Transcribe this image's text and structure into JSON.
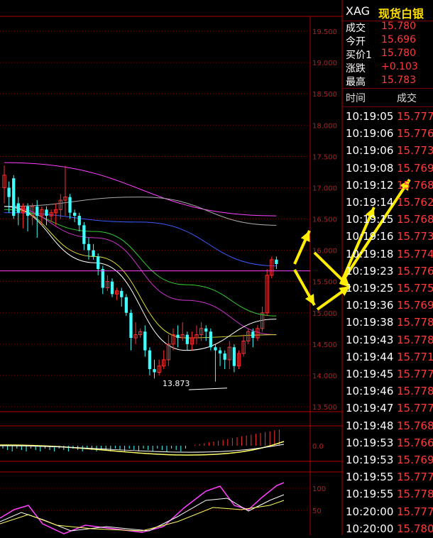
{
  "quote": {
    "symbol": "XAG",
    "name": "现货白银",
    "rows": [
      {
        "label": "成交",
        "value": "15.780"
      },
      {
        "label": "今开",
        "value": "15.696"
      },
      {
        "label": "买价1",
        "value": "15.780"
      },
      {
        "label": "涨跌",
        "value": "+0.103"
      },
      {
        "label": "最高",
        "value": "15.783"
      }
    ]
  },
  "trades": {
    "header_time": "时间",
    "header_price": "成交",
    "rows": [
      {
        "time": "10:19:05",
        "price": "15.777"
      },
      {
        "time": "10:19:06",
        "price": "15.776"
      },
      {
        "time": "10:19:06",
        "price": "15.773"
      },
      {
        "time": "10:19:08",
        "price": "15.769"
      },
      {
        "time": "10:19:12",
        "price": "15.768"
      },
      {
        "time": "10:19:14",
        "price": "15.762"
      },
      {
        "time": "10:19:15",
        "price": "15.768"
      },
      {
        "time": "10:19:16",
        "price": "15.773"
      },
      {
        "time": "10:19:18",
        "price": "15.774"
      },
      {
        "time": "10:19:23",
        "price": "15.776"
      },
      {
        "time": "10:19:25",
        "price": "15.775"
      },
      {
        "time": "10:19:36",
        "price": "15.769"
      },
      {
        "time": "10:19:38",
        "price": "15.778"
      },
      {
        "time": "10:19:43",
        "price": "15.778"
      },
      {
        "time": "10:19:44",
        "price": "15.771"
      },
      {
        "time": "10:19:45",
        "price": "15.777"
      },
      {
        "time": "10:19:46",
        "price": "15.778"
      },
      {
        "time": "10:19:47",
        "price": "15.777"
      },
      {
        "time": "10:19:48",
        "price": "15.768"
      },
      {
        "time": "10:19:53",
        "price": "15.766"
      },
      {
        "time": "10:19:53",
        "price": "15.769"
      },
      {
        "time": "10:19:55",
        "price": "15.777"
      },
      {
        "time": "10:19:55",
        "price": "15.778"
      },
      {
        "time": "10:20:00",
        "price": "15.777"
      },
      {
        "time": "10:20:00",
        "price": "15.780"
      }
    ]
  },
  "chart_data": [
    {
      "type": "candlestick",
      "ylim": [
        13.5,
        19.5
      ],
      "y_ticks": [
        "19.500",
        "19.000",
        "18.500",
        "18.000",
        "17.500",
        "17.000",
        "16.500",
        "16.000",
        "15.500",
        "15.000",
        "14.500",
        "14.000",
        "13.500"
      ],
      "annotations": [
        "13.873"
      ],
      "current_price_line": 15.67,
      "candles": [
        [
          17.0,
          17.2,
          16.75,
          17.35
        ],
        [
          17.0,
          16.85,
          16.6,
          17.1
        ],
        [
          17.15,
          16.55,
          16.5,
          17.2
        ],
        [
          16.75,
          16.6,
          16.4,
          16.85
        ],
        [
          16.6,
          16.7,
          16.35,
          16.75
        ],
        [
          16.7,
          16.55,
          16.3,
          16.75
        ],
        [
          16.55,
          16.7,
          16.4,
          16.75
        ],
        [
          16.7,
          16.55,
          16.2,
          16.8
        ],
        [
          16.55,
          16.65,
          16.4,
          16.7
        ],
        [
          16.65,
          16.55,
          16.4,
          16.7
        ],
        [
          16.55,
          16.6,
          16.45,
          16.65
        ],
        [
          16.6,
          16.65,
          16.4,
          16.75
        ],
        [
          16.65,
          16.8,
          16.5,
          16.9
        ],
        [
          16.8,
          16.85,
          16.55,
          17.35
        ],
        [
          16.85,
          16.6,
          16.5,
          16.9
        ],
        [
          16.6,
          16.55,
          16.45,
          16.65
        ],
        [
          16.55,
          16.4,
          16.3,
          16.6
        ],
        [
          16.4,
          16.1,
          16.0,
          16.45
        ],
        [
          16.1,
          16.0,
          15.85,
          16.2
        ],
        [
          16.0,
          15.9,
          15.85,
          16.1
        ],
        [
          15.9,
          15.7,
          15.6,
          15.95
        ],
        [
          15.7,
          15.4,
          15.3,
          15.75
        ],
        [
          15.4,
          15.5,
          15.35,
          15.6
        ],
        [
          15.5,
          15.3,
          15.25,
          15.55
        ],
        [
          15.3,
          15.35,
          15.2,
          15.4
        ],
        [
          15.35,
          15.25,
          15.1,
          15.4
        ],
        [
          15.25,
          15.0,
          14.95,
          15.3
        ],
        [
          15.0,
          14.6,
          14.4,
          15.05
        ],
        [
          14.6,
          14.65,
          14.5,
          14.85
        ],
        [
          14.65,
          14.7,
          14.6,
          14.75
        ],
        [
          14.7,
          14.4,
          14.3,
          14.8
        ],
        [
          14.4,
          14.1,
          14.0,
          14.45
        ],
        [
          14.1,
          14.05,
          13.95,
          14.25
        ],
        [
          14.05,
          14.15,
          14.0,
          14.25
        ],
        [
          14.15,
          14.25,
          14.1,
          14.4
        ],
        [
          14.25,
          14.5,
          14.15,
          14.65
        ],
        [
          14.5,
          14.65,
          14.4,
          14.75
        ],
        [
          14.65,
          14.6,
          14.45,
          14.8
        ],
        [
          14.6,
          14.65,
          14.55,
          14.85
        ],
        [
          14.65,
          14.5,
          14.4,
          14.7
        ],
        [
          14.5,
          14.6,
          14.4,
          14.7
        ],
        [
          14.6,
          14.65,
          14.5,
          14.8
        ],
        [
          14.65,
          14.75,
          14.55,
          14.85
        ],
        [
          14.75,
          14.7,
          14.55,
          14.8
        ],
        [
          14.7,
          14.45,
          14.4,
          14.75
        ],
        [
          14.45,
          14.4,
          13.9,
          14.5
        ],
        [
          14.4,
          14.35,
          14.15,
          14.45
        ],
        [
          14.35,
          14.25,
          14.1,
          14.4
        ],
        [
          14.25,
          14.45,
          14.1,
          14.55
        ],
        [
          14.45,
          14.15,
          14.05,
          14.5
        ],
        [
          14.15,
          14.35,
          14.1,
          14.4
        ],
        [
          14.35,
          14.55,
          14.3,
          14.65
        ],
        [
          14.55,
          14.7,
          14.5,
          14.75
        ],
        [
          14.7,
          14.6,
          14.45,
          14.75
        ],
        [
          14.6,
          14.75,
          14.55,
          14.8
        ],
        [
          14.75,
          15.0,
          14.7,
          15.1
        ],
        [
          15.0,
          15.6,
          14.95,
          15.7
        ],
        [
          15.6,
          15.85,
          15.55,
          15.9
        ],
        [
          15.85,
          15.78,
          15.7,
          15.9
        ]
      ],
      "moving_averages": [
        {
          "color": "#ff40ff",
          "values": [
            17.4,
            16.55
          ]
        },
        {
          "color": "#aaaaaa",
          "values": [
            16.7,
            16.85,
            16.4
          ]
        },
        {
          "color": "#3a5bff",
          "values": [
            16.6,
            16.45,
            15.75
          ]
        },
        {
          "color": "#33cc33",
          "values": [
            16.65,
            16.3,
            15.45,
            14.95
          ]
        },
        {
          "color": "#cc33cc",
          "values": [
            16.7,
            16.2,
            15.2,
            14.65
          ]
        },
        {
          "color": "#dddd33",
          "values": [
            16.7,
            15.9,
            14.6,
            14.65
          ]
        },
        {
          "color": "#ffffff",
          "values": [
            16.7,
            15.8,
            14.4,
            14.9
          ]
        }
      ]
    },
    {
      "type": "bar",
      "ylabel_ticks": [
        "0.0"
      ]
    },
    {
      "type": "line",
      "ylabel_ticks": [
        "100",
        "50"
      ]
    }
  ]
}
